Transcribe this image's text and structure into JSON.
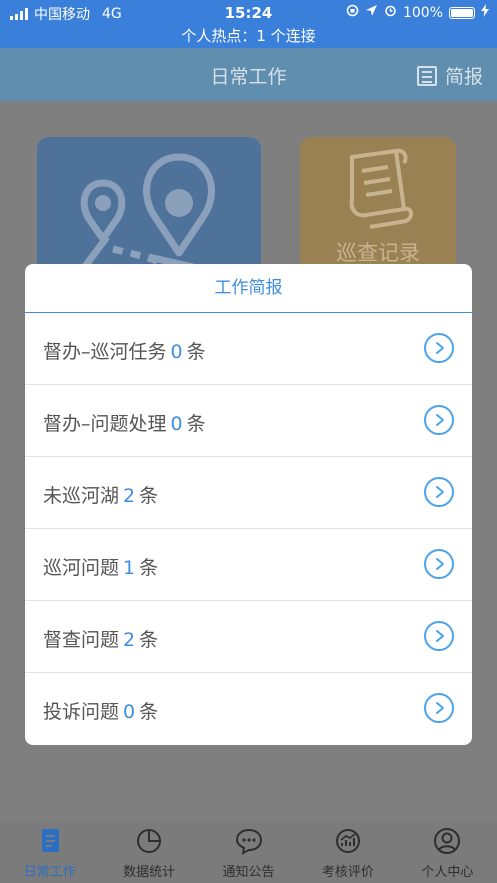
{
  "status_bar": {
    "carrier": "中国移动",
    "network": "4G",
    "time": "15:24",
    "battery": "100%",
    "hotspot": "个人热点：1 个连接"
  },
  "navbar": {
    "title": "日常工作",
    "right_label": "简报",
    "right_icon": "report-icon"
  },
  "cards": {
    "record_label": "巡查记录"
  },
  "dialog": {
    "title": "工作简报",
    "unit": "条",
    "items": [
      {
        "label": "督办–巡河任务",
        "count": "0"
      },
      {
        "label": "督办–问题处理",
        "count": "0"
      },
      {
        "label": "未巡河湖",
        "count": "2"
      },
      {
        "label": "巡河问题",
        "count": "1"
      },
      {
        "label": "督查问题",
        "count": "2"
      },
      {
        "label": "投诉问题",
        "count": "0"
      }
    ]
  },
  "tabbar": {
    "active_color": "#2b6fc4",
    "items": [
      {
        "label": "日常工作",
        "icon": "document-icon"
      },
      {
        "label": "数据统计",
        "icon": "pie-chart-icon"
      },
      {
        "label": "通知公告",
        "icon": "chat-bubble-icon"
      },
      {
        "label": "考核评价",
        "icon": "trend-chart-icon"
      },
      {
        "label": "个人中心",
        "icon": "user-icon"
      }
    ]
  }
}
